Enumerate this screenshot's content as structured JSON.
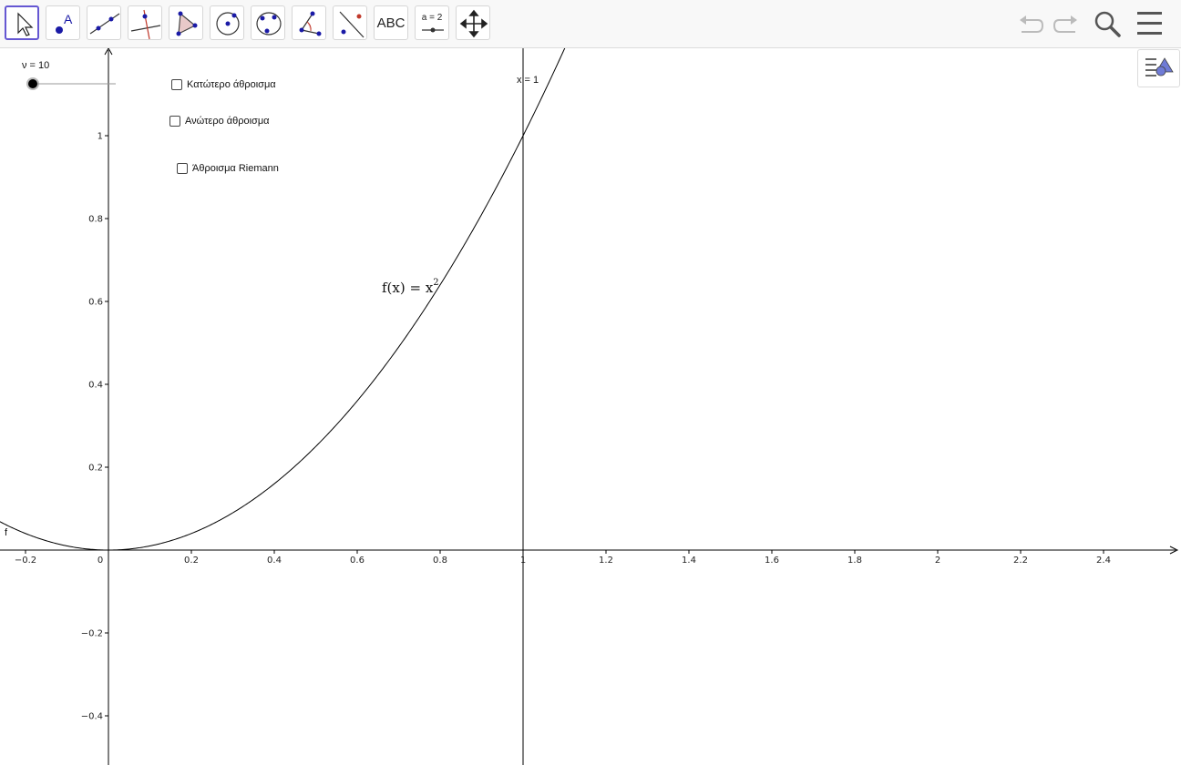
{
  "toolbar": {
    "tools": [
      {
        "name": "move-tool",
        "active": true
      },
      {
        "name": "point-tool"
      },
      {
        "name": "line-tool"
      },
      {
        "name": "perpendicular-line-tool"
      },
      {
        "name": "polygon-tool"
      },
      {
        "name": "circle-center-point-tool"
      },
      {
        "name": "conic-tool"
      },
      {
        "name": "angle-tool"
      },
      {
        "name": "reflect-tool"
      },
      {
        "name": "text-tool",
        "label": "ABC"
      },
      {
        "name": "slider-tool",
        "label": "a = 2"
      },
      {
        "name": "move-graphics-view-tool"
      }
    ],
    "undo_icon": "undo-icon",
    "redo_icon": "redo-icon",
    "search_icon": "search-icon",
    "menu_icon": "menu-icon"
  },
  "slider": {
    "label": "ν = 10",
    "value": 10
  },
  "checkboxes": {
    "lower_sum": "Κατώτερο άθροισμα",
    "upper_sum": "Ανώτερο άθροισμα",
    "riemann_sum": "Άθροισμα Riemann"
  },
  "function": {
    "label": "f(x) = x",
    "exponent": "2",
    "name": "f"
  },
  "vertical_line": {
    "label": "x = 1"
  },
  "axes": {
    "x_ticks": [
      "−0.2",
      "0",
      "0.2",
      "0.4",
      "0.6",
      "0.8",
      "1",
      "1.2",
      "1.4",
      "1.6",
      "1.8",
      "2",
      "2.2",
      "2.4"
    ],
    "y_ticks": [
      "1",
      "0.8",
      "0.6",
      "0.4",
      "0.2",
      "−0.2",
      "−0.4"
    ]
  },
  "colors": {
    "accent": "#6557d2",
    "point": "#1a1aa6"
  }
}
